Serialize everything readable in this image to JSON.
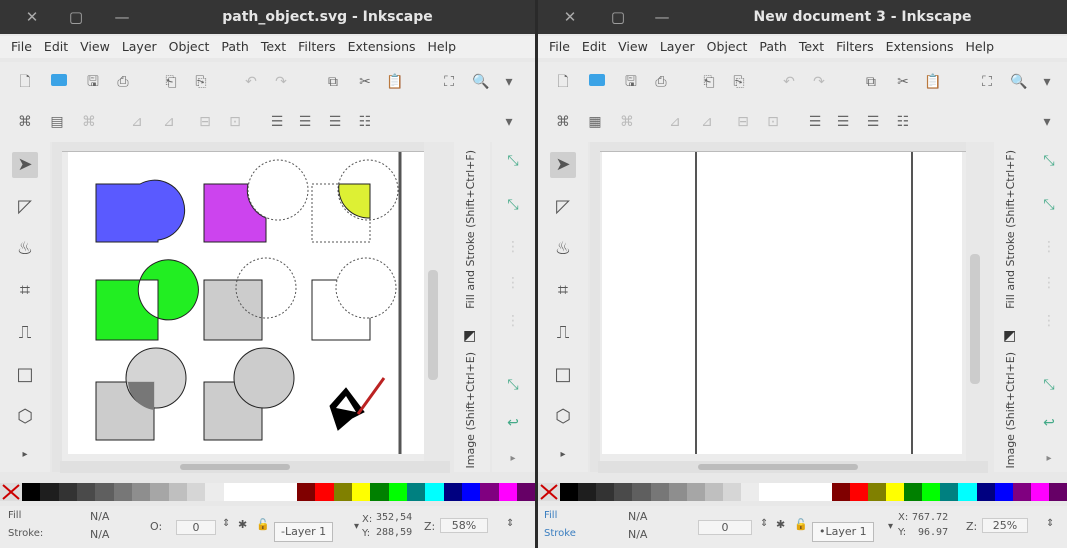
{
  "windows": {
    "left": {
      "title": "path_object.svg - Inkscape",
      "menu": [
        "File",
        "Edit",
        "View",
        "Layer",
        "Object",
        "Path",
        "Text",
        "Filters",
        "Extensions",
        "Help"
      ],
      "dock_fill_stroke": "Fill and Stroke (Shift+Ctrl+F)",
      "dock_image": "Image (Shift+Ctrl+E)",
      "status": {
        "fill_label": "Fill",
        "stroke_label": "Stroke:",
        "fill_value": "N/A",
        "stroke_value": "N/A",
        "opacity_label": "O:",
        "opacity_value": "0",
        "layer": "-Layer 1",
        "x_label": "X:",
        "y_label": "Y:",
        "x_value": "352,54",
        "y_value": "288,59",
        "zoom_label": "Z:",
        "zoom_value": "58%"
      }
    },
    "right": {
      "title": "New document 3 - Inkscape",
      "menu": [
        "File",
        "Edit",
        "View",
        "Layer",
        "Object",
        "Path",
        "Text",
        "Filters",
        "Extensions",
        "Help"
      ],
      "dock_fill_stroke": "Fill and Stroke (Shift+Ctrl+F)",
      "dock_image": "Image (Shift+Ctrl+E)",
      "status": {
        "fill_label": "Fill",
        "stroke_label": "Stroke",
        "fill_value": "N/A",
        "stroke_value": "N/A",
        "opacity_value": "0",
        "layer": "•Layer 1",
        "x_label": "X:",
        "y_label": "Y:",
        "x_value": "767.72",
        "y_value": "96.97",
        "zoom_label": "Z:",
        "zoom_value": "25%"
      }
    }
  },
  "palette_colors": [
    "#000000",
    "#1e1e1e",
    "#333333",
    "#4a4a4a",
    "#5f5f5f",
    "#777777",
    "#8e8e8e",
    "#a6a6a6",
    "#bfbfbf",
    "#d6d6d6",
    "#ececec",
    "#ffffff",
    "#ffffff",
    "#ffffff",
    "#ffffff",
    "#800000",
    "#ff0000",
    "#808000",
    "#ffff00",
    "#008000",
    "#00ff00",
    "#008080",
    "#00ffff",
    "#000080",
    "#0000ff",
    "#800080",
    "#ff00ff",
    "#660066"
  ],
  "colors": {
    "blue_shape": "#5a5aff",
    "magenta_shape": "#cc44ee",
    "yellow_shape": "#ddf034",
    "green_shape": "#22ee22",
    "gray_shape": "#cccccc"
  }
}
